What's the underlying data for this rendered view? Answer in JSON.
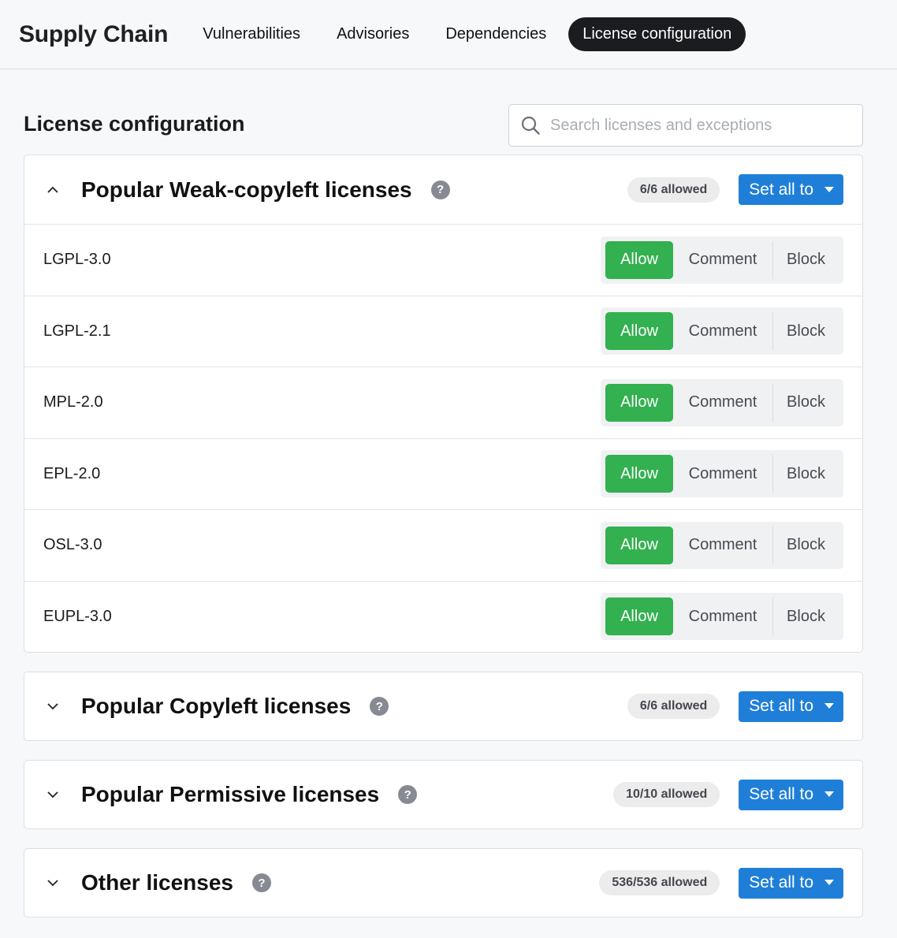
{
  "header": {
    "brand": "Supply Chain",
    "tabs": [
      {
        "label": "Vulnerabilities",
        "active": false
      },
      {
        "label": "Advisories",
        "active": false
      },
      {
        "label": "Dependencies",
        "active": false
      },
      {
        "label": "License configuration",
        "active": true
      }
    ]
  },
  "page": {
    "title": "License configuration",
    "search": {
      "placeholder": "Search licenses and exceptions",
      "value": ""
    }
  },
  "sections": [
    {
      "title": "Popular Weak-copyleft licenses",
      "expanded": true,
      "count": "6/6 allowed",
      "set_all_label": "Set all to",
      "licenses": [
        {
          "name": "LGPL-3.0",
          "status": "Allow"
        },
        {
          "name": "LGPL-2.1",
          "status": "Allow"
        },
        {
          "name": "MPL-2.0",
          "status": "Allow"
        },
        {
          "name": "EPL-2.0",
          "status": "Allow"
        },
        {
          "name": "OSL-3.0",
          "status": "Allow"
        },
        {
          "name": "EUPL-3.0",
          "status": "Allow"
        }
      ]
    },
    {
      "title": "Popular Copyleft licenses",
      "expanded": false,
      "count": "6/6 allowed",
      "set_all_label": "Set all to"
    },
    {
      "title": "Popular Permissive licenses",
      "expanded": false,
      "count": "10/10 allowed",
      "set_all_label": "Set all to"
    },
    {
      "title": "Other licenses",
      "expanded": false,
      "count": "536/536 allowed",
      "set_all_label": "Set all to"
    }
  ],
  "segment_options": {
    "allow": "Allow",
    "comment": "Comment",
    "block": "Block"
  },
  "icons": {
    "help": "?"
  },
  "colors": {
    "allow_selected": "#33b04f",
    "primary_button": "#1f7fd8",
    "active_tab": "#1b1c1f"
  }
}
